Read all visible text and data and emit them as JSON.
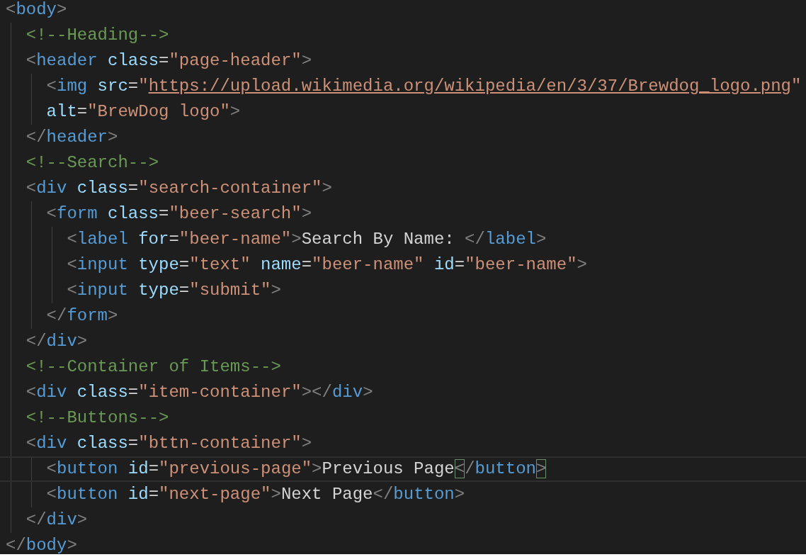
{
  "editor": {
    "lines": [
      {
        "tokens": [
          {
            "kind": "punct",
            "text": "<"
          },
          {
            "kind": "tag",
            "text": "body"
          },
          {
            "kind": "punct",
            "text": ">"
          }
        ],
        "children": [
          {
            "tokens": [
              {
                "kind": "comment",
                "text": "<!--Heading-->"
              }
            ]
          },
          {
            "tokens": [
              {
                "kind": "punct",
                "text": "<"
              },
              {
                "kind": "tag",
                "text": "header"
              },
              {
                "kind": "attr",
                "text": " class"
              },
              {
                "kind": "text",
                "text": "="
              },
              {
                "kind": "string",
                "text": "\"page-header\""
              },
              {
                "kind": "punct",
                "text": ">"
              }
            ],
            "children": [
              {
                "tokens": [
                  {
                    "kind": "punct",
                    "text": "<"
                  },
                  {
                    "kind": "tag",
                    "text": "img"
                  },
                  {
                    "kind": "attr",
                    "text": " src"
                  },
                  {
                    "kind": "text",
                    "text": "="
                  },
                  {
                    "kind": "string",
                    "text": "\""
                  },
                  {
                    "kind": "link",
                    "text": "https://upload.wikimedia.org/wikipedia/en/3/37/Brewdog_logo.png"
                  },
                  {
                    "kind": "string",
                    "text": "\""
                  }
                ]
              },
              {
                "tokens": [
                  {
                    "kind": "attr",
                    "text": "alt"
                  },
                  {
                    "kind": "text",
                    "text": "="
                  },
                  {
                    "kind": "string",
                    "text": "\"BrewDog logo\""
                  },
                  {
                    "kind": "punct",
                    "text": ">"
                  }
                ]
              }
            ]
          },
          {
            "tokens": [
              {
                "kind": "punct",
                "text": "</"
              },
              {
                "kind": "tag",
                "text": "header"
              },
              {
                "kind": "punct",
                "text": ">"
              }
            ]
          },
          {
            "tokens": [
              {
                "kind": "comment",
                "text": "<!--Search-->"
              }
            ]
          },
          {
            "tokens": [
              {
                "kind": "punct",
                "text": "<"
              },
              {
                "kind": "tag",
                "text": "div"
              },
              {
                "kind": "attr",
                "text": " class"
              },
              {
                "kind": "text",
                "text": "="
              },
              {
                "kind": "string",
                "text": "\"search-container\""
              },
              {
                "kind": "punct",
                "text": ">"
              }
            ],
            "children": [
              {
                "tokens": [
                  {
                    "kind": "punct",
                    "text": "<"
                  },
                  {
                    "kind": "tag",
                    "text": "form"
                  },
                  {
                    "kind": "attr",
                    "text": " class"
                  },
                  {
                    "kind": "text",
                    "text": "="
                  },
                  {
                    "kind": "string",
                    "text": "\"beer-search\""
                  },
                  {
                    "kind": "punct",
                    "text": ">"
                  }
                ],
                "children": [
                  {
                    "tokens": [
                      {
                        "kind": "punct",
                        "text": "<"
                      },
                      {
                        "kind": "tag",
                        "text": "label"
                      },
                      {
                        "kind": "attr",
                        "text": " for"
                      },
                      {
                        "kind": "text",
                        "text": "="
                      },
                      {
                        "kind": "string",
                        "text": "\"beer-name\""
                      },
                      {
                        "kind": "punct",
                        "text": ">"
                      },
                      {
                        "kind": "text",
                        "text": "Search By Name: "
                      },
                      {
                        "kind": "punct",
                        "text": "</"
                      },
                      {
                        "kind": "tag",
                        "text": "label"
                      },
                      {
                        "kind": "punct",
                        "text": ">"
                      }
                    ]
                  },
                  {
                    "tokens": [
                      {
                        "kind": "punct",
                        "text": "<"
                      },
                      {
                        "kind": "tag",
                        "text": "input"
                      },
                      {
                        "kind": "attr",
                        "text": " type"
                      },
                      {
                        "kind": "text",
                        "text": "="
                      },
                      {
                        "kind": "string",
                        "text": "\"text\""
                      },
                      {
                        "kind": "attr",
                        "text": " name"
                      },
                      {
                        "kind": "text",
                        "text": "="
                      },
                      {
                        "kind": "string",
                        "text": "\"beer-name\""
                      },
                      {
                        "kind": "attr",
                        "text": " id"
                      },
                      {
                        "kind": "text",
                        "text": "="
                      },
                      {
                        "kind": "string",
                        "text": "\"beer-name\""
                      },
                      {
                        "kind": "punct",
                        "text": ">"
                      }
                    ]
                  },
                  {
                    "tokens": [
                      {
                        "kind": "punct",
                        "text": "<"
                      },
                      {
                        "kind": "tag",
                        "text": "input"
                      },
                      {
                        "kind": "attr",
                        "text": " type"
                      },
                      {
                        "kind": "text",
                        "text": "="
                      },
                      {
                        "kind": "string",
                        "text": "\"submit\""
                      },
                      {
                        "kind": "punct",
                        "text": ">"
                      }
                    ]
                  }
                ]
              },
              {
                "tokens": [
                  {
                    "kind": "punct",
                    "text": "</"
                  },
                  {
                    "kind": "tag",
                    "text": "form"
                  },
                  {
                    "kind": "punct",
                    "text": ">"
                  }
                ]
              }
            ]
          },
          {
            "tokens": [
              {
                "kind": "punct",
                "text": "</"
              },
              {
                "kind": "tag",
                "text": "div"
              },
              {
                "kind": "punct",
                "text": ">"
              }
            ]
          },
          {
            "tokens": [
              {
                "kind": "comment",
                "text": "<!--Container of Items-->"
              }
            ]
          },
          {
            "tokens": [
              {
                "kind": "punct",
                "text": "<"
              },
              {
                "kind": "tag",
                "text": "div"
              },
              {
                "kind": "attr",
                "text": " class"
              },
              {
                "kind": "text",
                "text": "="
              },
              {
                "kind": "string",
                "text": "\"item-container\""
              },
              {
                "kind": "punct",
                "text": "></"
              },
              {
                "kind": "tag",
                "text": "div"
              },
              {
                "kind": "punct",
                "text": ">"
              }
            ]
          },
          {
            "tokens": [
              {
                "kind": "comment",
                "text": "<!--Buttons-->"
              }
            ]
          },
          {
            "tokens": [
              {
                "kind": "punct",
                "text": "<"
              },
              {
                "kind": "tag",
                "text": "div"
              },
              {
                "kind": "attr",
                "text": " class"
              },
              {
                "kind": "text",
                "text": "="
              },
              {
                "kind": "string",
                "text": "\"bttn-container\""
              },
              {
                "kind": "punct",
                "text": ">"
              }
            ],
            "children": [
              {
                "current": true,
                "tokens": [
                  {
                    "kind": "punct",
                    "text": "<"
                  },
                  {
                    "kind": "tag",
                    "text": "button"
                  },
                  {
                    "kind": "attr",
                    "text": " id"
                  },
                  {
                    "kind": "text",
                    "text": "="
                  },
                  {
                    "kind": "string",
                    "text": "\"previous-page\""
                  },
                  {
                    "kind": "punct",
                    "text": ">"
                  },
                  {
                    "kind": "text",
                    "text": "Previous Page"
                  },
                  {
                    "kind": "punct",
                    "text": "<",
                    "matched": true
                  },
                  {
                    "kind": "punct",
                    "text": "/"
                  },
                  {
                    "kind": "tag",
                    "text": "button"
                  },
                  {
                    "kind": "punct",
                    "text": ">",
                    "matched": true
                  }
                ]
              },
              {
                "current": false,
                "tokens": [
                  {
                    "kind": "punct",
                    "text": "<"
                  },
                  {
                    "kind": "tag",
                    "text": "button"
                  },
                  {
                    "kind": "attr",
                    "text": " id"
                  },
                  {
                    "kind": "text",
                    "text": "="
                  },
                  {
                    "kind": "string",
                    "text": "\"next-page\""
                  },
                  {
                    "kind": "punct",
                    "text": ">"
                  },
                  {
                    "kind": "text",
                    "text": "Next Page"
                  },
                  {
                    "kind": "punct",
                    "text": "</"
                  },
                  {
                    "kind": "tag",
                    "text": "button"
                  },
                  {
                    "kind": "punct",
                    "text": ">"
                  }
                ]
              }
            ]
          },
          {
            "tokens": [
              {
                "kind": "punct",
                "text": "</"
              },
              {
                "kind": "tag",
                "text": "div"
              },
              {
                "kind": "punct",
                "text": ">"
              }
            ]
          }
        ]
      },
      {
        "tokens": [
          {
            "kind": "punct",
            "text": "</"
          },
          {
            "kind": "tag",
            "text": "body"
          },
          {
            "kind": "punct",
            "text": ">"
          }
        ]
      }
    ]
  }
}
